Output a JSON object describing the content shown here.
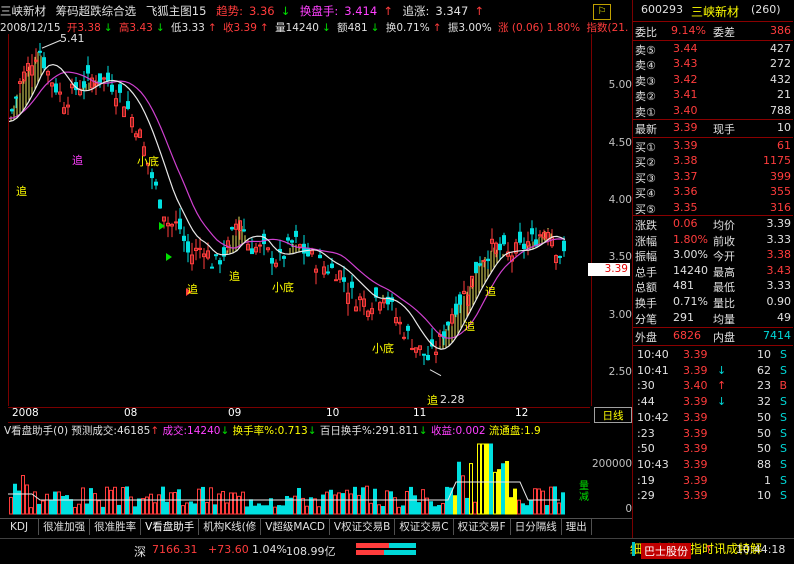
{
  "header": {
    "stock_name": "三峡新材",
    "indicator_name": "筹码超跌综合选",
    "indicator_alt": "飞狐主图15",
    "trend_label": "趋势:",
    "trend_value": "3.36",
    "trend_arrow": "↓",
    "turnover_hand_label": "换盘手:",
    "turnover_hand_value": "3.414",
    "turnover_hand_arrow": "↑",
    "chase_label": "追涨:",
    "chase_value": "3.347",
    "chase_arrow": "↑"
  },
  "ohlc": {
    "date": "2008/12/15",
    "open": "开3.38",
    "open_arrow": "↓",
    "high": "高3.43",
    "high_arrow": "↓",
    "low": "低3.33",
    "low_arrow": "↑",
    "close": "收3.39",
    "close_arrow": "↑",
    "volume": "量14240",
    "volume_arrow": "↓",
    "amount": "额481",
    "amount_arrow": "↓",
    "turnover": "换0.71%",
    "turnover_arrow": "↑",
    "amplitude": "振3.00%",
    "change": "涨 (0.06) 1.80%",
    "index": "指数(21."
  },
  "price_axis": [
    "5.00",
    "4.50",
    "4.00",
    "3.50",
    "3.00",
    "2.50"
  ],
  "price_tag": "3.39",
  "annotations": {
    "high_label": "5.41",
    "low_label": "2.28",
    "zhui": "追",
    "xiaodi": "小底"
  },
  "x_axis": [
    "2008",
    "08",
    "09",
    "10",
    "11",
    "12"
  ],
  "day_line_label": "日线",
  "volume_header": {
    "assistant": "V看盘助手(0)",
    "forecast": "预测成交:46185",
    "forecast_arrow": "↑",
    "deal": "成交:14240",
    "deal_arrow": "↓",
    "turnover_rate": "换手率%:0.713",
    "turnover_rate_arrow": "↓",
    "hundred_day": "百日换手%:291.811",
    "hundred_day_arrow": "↓",
    "income": "收益:0.002",
    "float": "流通盘:1.9"
  },
  "volume_axis": [
    "200000",
    "0"
  ],
  "volume_side_label": "量\n减",
  "tabs": [
    "KDJ",
    "很准加强",
    "很准胜率",
    "V看盘助手",
    "机构K线(修",
    "V超级MACD",
    "V权证交易B",
    "权证交易C",
    "权证交易F",
    "日分隔线",
    "理出"
  ],
  "status": {
    "index_name": "深",
    "index_value": "7166.31",
    "index_change": "+73.60",
    "index_pct": "1.04%",
    "index_amount": "108.99亿",
    "ticker_text": "细价盘势周指时讯成特解",
    "news_stock": "巴士股份",
    "news_arrow": "↑",
    "time": "10:44:18"
  },
  "quote": {
    "code": "600293",
    "name": "三峡新材",
    "id": "(260)",
    "weibi_label": "委比",
    "weibi_value": "9.14%",
    "weicha_label": "委差",
    "weicha_value": "386",
    "sells": [
      {
        "label": "卖⑤",
        "price": "3.44",
        "vol": "427"
      },
      {
        "label": "卖④",
        "price": "3.43",
        "vol": "272"
      },
      {
        "label": "卖③",
        "price": "3.42",
        "vol": "432"
      },
      {
        "label": "卖②",
        "price": "3.41",
        "vol": "21"
      },
      {
        "label": "卖①",
        "price": "3.40",
        "vol": "788"
      }
    ],
    "latest_label": "最新",
    "latest_value": "3.39",
    "now_hand_label": "现手",
    "now_hand_value": "10",
    "buys": [
      {
        "label": "买①",
        "price": "3.39",
        "vol": "61"
      },
      {
        "label": "买②",
        "price": "3.38",
        "vol": "1175"
      },
      {
        "label": "买③",
        "price": "3.37",
        "vol": "399"
      },
      {
        "label": "买④",
        "price": "3.36",
        "vol": "355"
      },
      {
        "label": "买⑤",
        "price": "3.35",
        "vol": "316"
      }
    ],
    "stats": [
      {
        "l1": "涨跌",
        "v1": "0.06",
        "l2": "均价",
        "v2": "3.39",
        "c1": "red",
        "c2": "white"
      },
      {
        "l1": "涨幅",
        "v1": "1.80%",
        "l2": "前收",
        "v2": "3.33",
        "c1": "red",
        "c2": "white"
      },
      {
        "l1": "振幅",
        "v1": "3.00%",
        "l2": "今开",
        "v2": "3.38",
        "c1": "white",
        "c2": "red"
      },
      {
        "l1": "总手",
        "v1": "14240",
        "l2": "最高",
        "v2": "3.43",
        "c1": "white",
        "c2": "red"
      },
      {
        "l1": "总额",
        "v1": "481",
        "l2": "最低",
        "v2": "3.33",
        "c1": "white",
        "c2": "white"
      },
      {
        "l1": "换手",
        "v1": "0.71%",
        "l2": "量比",
        "v2": "0.90",
        "c1": "white",
        "c2": "white"
      },
      {
        "l1": "分笔",
        "v1": "291",
        "l2": "均量",
        "v2": "49",
        "c1": "white",
        "c2": "white"
      }
    ],
    "outer_label": "外盘",
    "outer_value": "6826",
    "inner_label": "内盘",
    "inner_value": "7414",
    "ticks": [
      {
        "t": "10:40",
        "p": "3.39",
        "a": "",
        "v": "10",
        "f": "S"
      },
      {
        "t": "10:41",
        "p": "3.39",
        "a": "↓",
        "v": "62",
        "f": "S"
      },
      {
        "t": ":30",
        "p": "3.40",
        "a": "↑",
        "v": "23",
        "f": "B"
      },
      {
        "t": ":44",
        "p": "3.39",
        "a": "↓",
        "v": "32",
        "f": "S"
      },
      {
        "t": "10:42",
        "p": "3.39",
        "a": "",
        "v": "50",
        "f": "S"
      },
      {
        "t": ":23",
        "p": "3.39",
        "a": "",
        "v": "50",
        "f": "S"
      },
      {
        "t": ":50",
        "p": "3.39",
        "a": "",
        "v": "50",
        "f": "S"
      },
      {
        "t": "10:43",
        "p": "3.39",
        "a": "",
        "v": "88",
        "f": "S"
      },
      {
        "t": ":19",
        "p": "3.39",
        "a": "",
        "v": "1",
        "f": "S"
      },
      {
        "t": ":29",
        "p": "3.39",
        "a": "",
        "v": "10",
        "f": "S"
      }
    ]
  },
  "colors": {
    "up": "#ff3c3c",
    "down": "#00e0e0",
    "ma_white": "#e8e8e8",
    "ma_magenta": "#d040d0",
    "chip": "#e8e060",
    "grid": "#7a0000"
  }
}
